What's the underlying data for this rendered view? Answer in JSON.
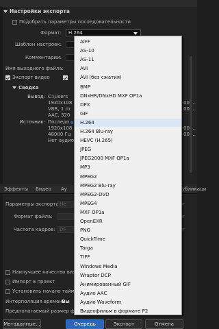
{
  "export_settings": {
    "section_title": "Настройки экспорта",
    "match_sequence_label": "Подобрать параметры последовательности",
    "format_label": "Формат:",
    "format_value": "H.264",
    "preset_label": "Шаблон настроек:",
    "comments_label": "Комментарии:",
    "output_name_label": "Имя выходного файла:",
    "export_video_label": "Экспорт видео"
  },
  "summary": {
    "title": "Сводка",
    "output_label": "Вывод:",
    "output_line1": "C:\\Users",
    "output_line2": "1920x108",
    "output_line3": "VBR, 1 m",
    "output_line4": "AAC, 320",
    "output_right1": "00:...",
    "output_right2": "00:...",
    "source_label": "Источник:",
    "source_line1": "Последо",
    "source_line2": "1920x108",
    "source_line3": "48000 Гц",
    "source_line4": "Нет аудио",
    "source_right1": "00:...",
    "source_right2": "00:..."
  },
  "tabs": {
    "effects": "Эффекты",
    "video": "Видео",
    "audio_partial": "Ау",
    "publish_partial": "убликаци"
  },
  "video_settings": {
    "export_params_label": "Параметры экспорта:",
    "export_params_value": "Не",
    "frame_format_label": "Формат файла:",
    "frame_rate_label": "Частота кадров:",
    "frame_rate_value": "DF"
  },
  "bottom": {
    "max_quality_label": "Наилучшее качество визу",
    "import_project_label": "Импорт в проект",
    "timecode_label": "Установить начало тайм-к",
    "interpolation_label": "Интерполяция времени:",
    "interpolation_value": "Вы",
    "filesize_label": "Предполагаемый размер фа"
  },
  "buttons": {
    "metadata": "Метаданные...",
    "queue": "Очередь",
    "export": "Экспорт",
    "cancel": "Отмена"
  },
  "format_menu": {
    "selected": "H.264",
    "items": [
      "AIFF",
      "AS-10",
      "AS-11",
      "AVI",
      "AVI (без сжатия)",
      "BMP",
      "DNxHR/DNxHD MXF OP1a",
      "DPX",
      "GIF",
      "H.264",
      "H.264 Blu-ray",
      "HEVC (H.265)",
      "JPEG",
      "JPEG2000 MXF OP1a",
      "MP3",
      "MPEG2",
      "MPEG2 Blu-ray",
      "MPEG2-DVD",
      "MPEG4",
      "MXF OP1a",
      "OpenEXR",
      "PNG",
      "QuickTime",
      "Targa",
      "TIFF",
      "Windows Media",
      "Wraptor DCP",
      "Анимированный GIF",
      "Аудио AAC",
      "Аудио Waveform",
      "Видеофильм в формате P2"
    ]
  },
  "colors": {
    "accent": "#2e66b5",
    "menu_bg": "#f0f0f0",
    "panel_bg": "#232323"
  }
}
